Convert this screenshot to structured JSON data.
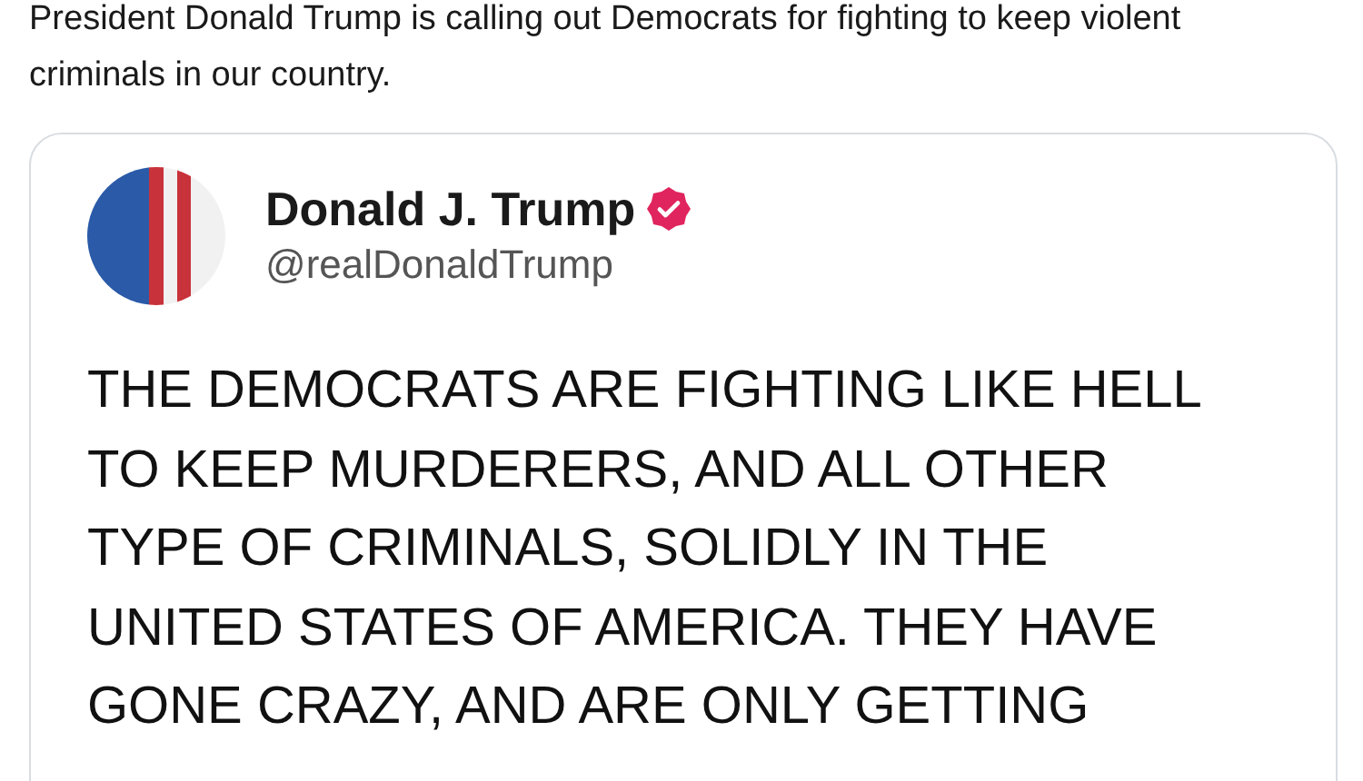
{
  "caption": "President Donald Trump is calling out Democrats for fighting to keep violent criminals in our country.",
  "post": {
    "author": {
      "name": "Donald J. Trump",
      "verified": true,
      "handle": "@realDonaldTrump"
    },
    "body": "THE DEMOCRATS ARE FIGHTING LIKE HELL\nTO KEEP MURDERERS, AND ALL OTHER\nTYPE OF CRIMINALS, SOLIDLY IN THE\nUNITED STATES OF AMERICA. THEY HAVE\nGONE CRAZY, AND ARE ONLY GETTING"
  }
}
